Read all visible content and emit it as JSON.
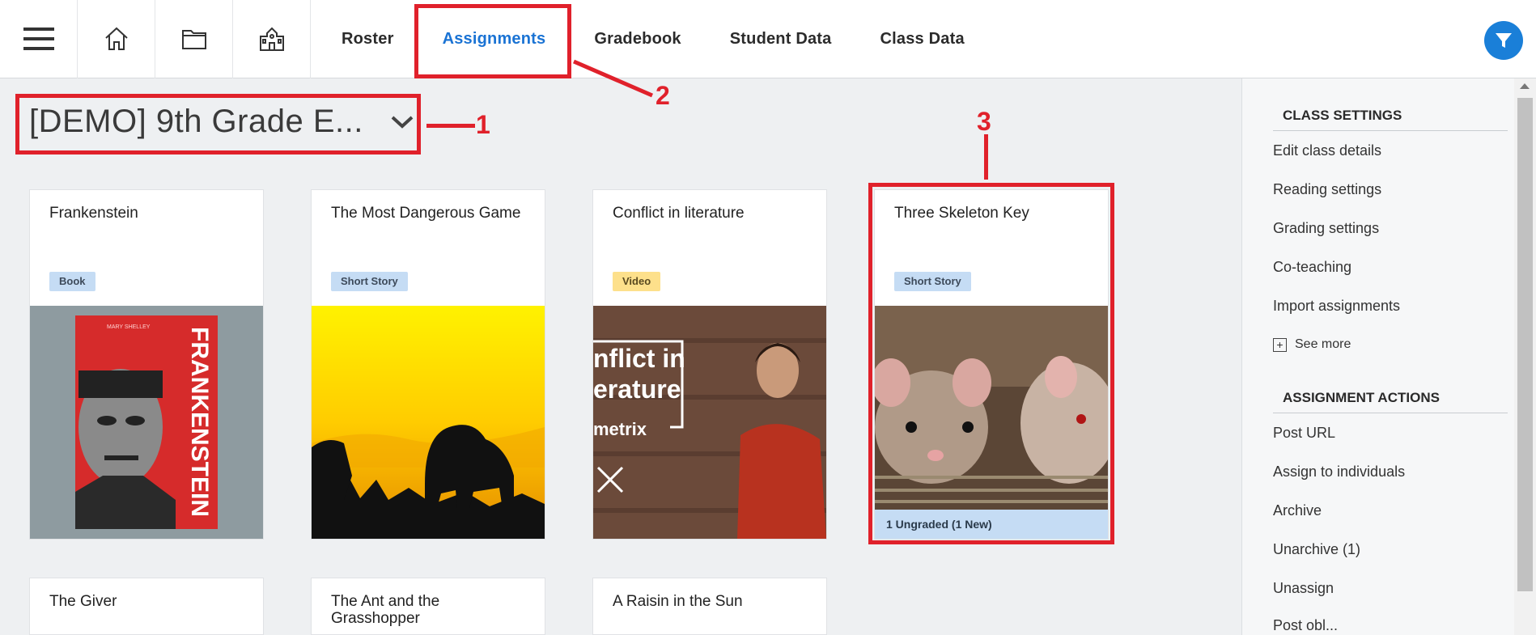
{
  "topbar": {
    "icons": [
      "menu-icon",
      "home-icon",
      "folder-icon",
      "school-icon"
    ],
    "tabs": [
      "Roster",
      "Assignments",
      "Gradebook",
      "Student Data",
      "Class Data"
    ],
    "active_tab": "Assignments",
    "filter_icon": "filter-icon"
  },
  "class_selector": {
    "value": "[DEMO] 9th Grade E..."
  },
  "cards": [
    {
      "title": "Frankenstein",
      "badge": "Book",
      "cover_author": "MARY SHELLEY",
      "cover_title": "FRANKENSTEIN"
    },
    {
      "title": "The Most Dangerous Game",
      "badge": "Short Story"
    },
    {
      "title": "Conflict in literature",
      "badge": "Video",
      "thumb_text_line1": "nflict in",
      "thumb_text_line2": "erature",
      "thumb_text_line3": "metrix"
    },
    {
      "title": "Three Skeleton Key",
      "badge": "Short Story",
      "status": "1 Ungraded (1 New)"
    },
    {
      "title": "The Giver"
    },
    {
      "title": "The Ant and the Grasshopper"
    },
    {
      "title": "A Raisin in the Sun"
    }
  ],
  "sidebar": {
    "class_settings_header": "CLASS SETTINGS",
    "class_settings": [
      "Edit class details",
      "Reading settings",
      "Grading settings",
      "Co-teaching",
      "Import assignments"
    ],
    "see_more": "See more",
    "assignment_actions_header": "ASSIGNMENT ACTIONS",
    "assignment_actions": [
      "Post URL",
      "Assign to individuals",
      "Archive",
      "Unarchive (1)",
      "Unassign",
      "Post obl..."
    ]
  },
  "annotations": [
    "1",
    "2",
    "3"
  ],
  "colors": {
    "accent": "#1a73d4",
    "annotation_red": "#e0212b",
    "badge_blue": "#c5dcf4",
    "badge_yellow": "#fde08b"
  }
}
